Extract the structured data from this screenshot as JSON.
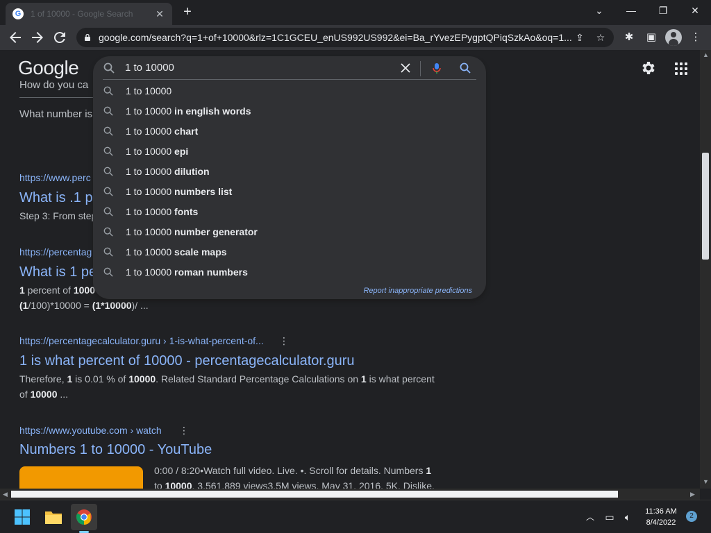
{
  "browser": {
    "tab_title": "1 of 10000 - Google Search",
    "new_tab": "+",
    "url": "google.com/search?q=1+of+10000&rlz=1C1GCEU_enUS992US992&ei=Ba_rYvezEPygptQPiqSzkAo&oq=1..."
  },
  "header": {
    "logo": "Google"
  },
  "search": {
    "query": "1 to 10000",
    "suggestions": [
      {
        "prefix": "1 to 10000",
        "bold": ""
      },
      {
        "prefix": "1 to 10000",
        "bold": " in english words"
      },
      {
        "prefix": "1 to 10000",
        "bold": " chart"
      },
      {
        "prefix": "1 to 10000",
        "bold": " epi"
      },
      {
        "prefix": "1 to 10000",
        "bold": " dilution"
      },
      {
        "prefix": "1 to 10000",
        "bold": " numbers list"
      },
      {
        "prefix": "1 to 10000",
        "bold": " fonts"
      },
      {
        "prefix": "1 to 10000",
        "bold": " number generator"
      },
      {
        "prefix": "1 to 10000",
        "bold": " scale maps"
      },
      {
        "prefix": "1 to 10000",
        "bold": " roman numbers"
      }
    ],
    "report_link": "Report inappropriate predictions"
  },
  "results": {
    "peek1": "How do you ca",
    "peek2": "What number is",
    "r1_cite": "https://www.perc",
    "r1_title": "What is .1 p",
    "r1_snip": "Step 3: From step",
    "r2_cite": "https://percentag",
    "r2_title": "What is 1 pe",
    "r2_snip_a_bold": "1",
    "r2_snip_a": " percent of ",
    "r2_snip_a_bold2": "1000",
    "r2_snip_b_bold": "(1",
    "r2_snip_b": "/100)*10000 = ",
    "r2_snip_b_bold2": "(1*10000",
    "r2_snip_b_end": ")/ ...",
    "r3_cite": "https://percentagecalculator.guru › 1-is-what-percent-of...",
    "r3_title": "1 is what percent of 10000 - percentagecalculator.guru",
    "r3_snip_1": "Therefore, ",
    "r3_snip_b1": "1",
    "r3_snip_2": " is 0.01 % of ",
    "r3_snip_b2": "10000",
    "r3_snip_3": ". Related Standard Percentage Calculations on ",
    "r3_snip_b3": "1",
    "r3_snip_4": " is what percent",
    "r3_snip_5": "of ",
    "r3_snip_b4": "10000",
    "r3_snip_6": " ...",
    "r4_cite": "https://www.youtube.com › watch",
    "r4_title": "Numbers 1 to 10000 - YouTube",
    "r4_snip_1": "0:00 / 8:20•Watch full video. Live. •. Scroll for details. Numbers ",
    "r4_snip_b1": "1",
    "r4_snip_2": "to ",
    "r4_snip_b2": "10000",
    "r4_snip_3": ". 3,561,889 views3.5M views. May 31, 2016. 5K. Dislike."
  },
  "taskbar": {
    "time": "11:36 AM",
    "date": "8/4/2022",
    "notifications": "2"
  }
}
